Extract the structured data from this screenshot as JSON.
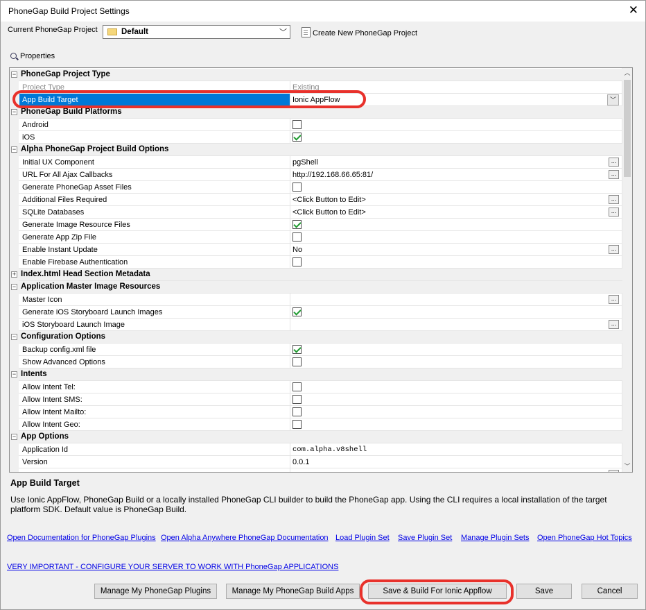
{
  "window": {
    "title": "PhoneGap Build Project Settings",
    "close": "✕"
  },
  "project": {
    "label": "Current PhoneGap Project",
    "value": "Default",
    "new_project": "Create New PhoneGap Project"
  },
  "properties_label": "Properties",
  "grid": {
    "rows": [
      {
        "kind": "cat",
        "label": "PhoneGap Project Type",
        "toggle": "−"
      },
      {
        "kind": "prop",
        "name": "Project Type",
        "value": "Existing",
        "disabled": true
      },
      {
        "kind": "prop",
        "name": "App Build Target",
        "value": "Ionic AppFlow",
        "selected": true,
        "control": "dropdown"
      },
      {
        "kind": "cat",
        "label": "PhoneGap Build Platforms",
        "toggle": "−"
      },
      {
        "kind": "prop",
        "name": "Android",
        "checkbox": false
      },
      {
        "kind": "prop",
        "name": "iOS",
        "checkbox": true
      },
      {
        "kind": "cat",
        "label": "Alpha PhoneGap Project Build Options",
        "toggle": "−"
      },
      {
        "kind": "prop",
        "name": "Initial UX Component",
        "value": "pgShell",
        "control": "ellipsis"
      },
      {
        "kind": "prop",
        "name": "URL For All Ajax Callbacks",
        "value": "http://192.168.66.65:81/",
        "control": "ellipsis"
      },
      {
        "kind": "prop",
        "name": "Generate PhoneGap Asset Files",
        "checkbox": false
      },
      {
        "kind": "prop",
        "name": "Additional Files Required",
        "value": "<Click Button to Edit>",
        "control": "ellipsis"
      },
      {
        "kind": "prop",
        "name": "SQLite Databases",
        "value": "<Click Button to Edit>",
        "control": "ellipsis"
      },
      {
        "kind": "prop",
        "name": "Generate Image Resource Files",
        "checkbox": true
      },
      {
        "kind": "prop",
        "name": "Generate App Zip File",
        "checkbox": false
      },
      {
        "kind": "prop",
        "name": "Enable Instant Update",
        "value": "No",
        "control": "ellipsis"
      },
      {
        "kind": "prop",
        "name": "Enable Firebase Authentication",
        "checkbox": false
      },
      {
        "kind": "cat",
        "label": "Index.html Head Section Metadata",
        "toggle": "+"
      },
      {
        "kind": "cat",
        "label": "Application Master Image Resources",
        "toggle": "−"
      },
      {
        "kind": "prop",
        "name": "Master Icon",
        "value": "",
        "control": "ellipsis"
      },
      {
        "kind": "prop",
        "name": "Generate iOS Storyboard Launch Images",
        "checkbox": true
      },
      {
        "kind": "prop",
        "name": "iOS Storyboard Launch Image",
        "value": "",
        "control": "ellipsis"
      },
      {
        "kind": "cat",
        "label": "Configuration Options",
        "toggle": "−"
      },
      {
        "kind": "prop",
        "name": "Backup config.xml file",
        "checkbox": true
      },
      {
        "kind": "prop",
        "name": "Show Advanced Options",
        "checkbox": false
      },
      {
        "kind": "cat",
        "label": "Intents",
        "toggle": "−"
      },
      {
        "kind": "prop",
        "name": "Allow Intent Tel:",
        "checkbox": false
      },
      {
        "kind": "prop",
        "name": "Allow Intent SMS:",
        "checkbox": false
      },
      {
        "kind": "prop",
        "name": "Allow Intent Mailto:",
        "checkbox": false
      },
      {
        "kind": "prop",
        "name": "Allow Intent Geo:",
        "checkbox": false
      },
      {
        "kind": "cat",
        "label": "App Options",
        "toggle": "−"
      },
      {
        "kind": "prop",
        "name": "Application Id",
        "value": "com.alpha.v8shell",
        "mono": true
      },
      {
        "kind": "prop",
        "name": "Version",
        "value": "0.0.1"
      },
      {
        "kind": "prop",
        "name": "",
        "value": "",
        "control": "ellipsis"
      }
    ]
  },
  "description": {
    "title": "App Build Target",
    "text": "Use Ionic AppFlow, PhoneGap Build or a locally installed PhoneGap CLI builder to build the PhoneGap app. Using the CLI requires a local installation of the target platform SDK. Default value is PhoneGap Build."
  },
  "links": [
    "Open Documentation for PhoneGap Plugins",
    "Open Alpha Anywhere PhoneGap Documentation",
    "Load Plugin Set",
    "Save Plugin Set",
    "Manage Plugin Sets",
    "Open PhoneGap Hot Topics"
  ],
  "important_link": "VERY IMPORTANT - CONFIGURE YOUR SERVER TO WORK WITH PhoneGap APPLICATIONS",
  "buttons": {
    "manage_plugins": "Manage My PhoneGap Plugins",
    "manage_build_apps": "Manage My PhoneGap Build Apps",
    "save_build": "Save & Build For Ionic Appflow",
    "save": "Save",
    "cancel": "Cancel"
  },
  "colors": {
    "selection": "#0078d7",
    "highlight": "#e8312b",
    "link": "#0000e6",
    "check": "#1e9a2f"
  }
}
